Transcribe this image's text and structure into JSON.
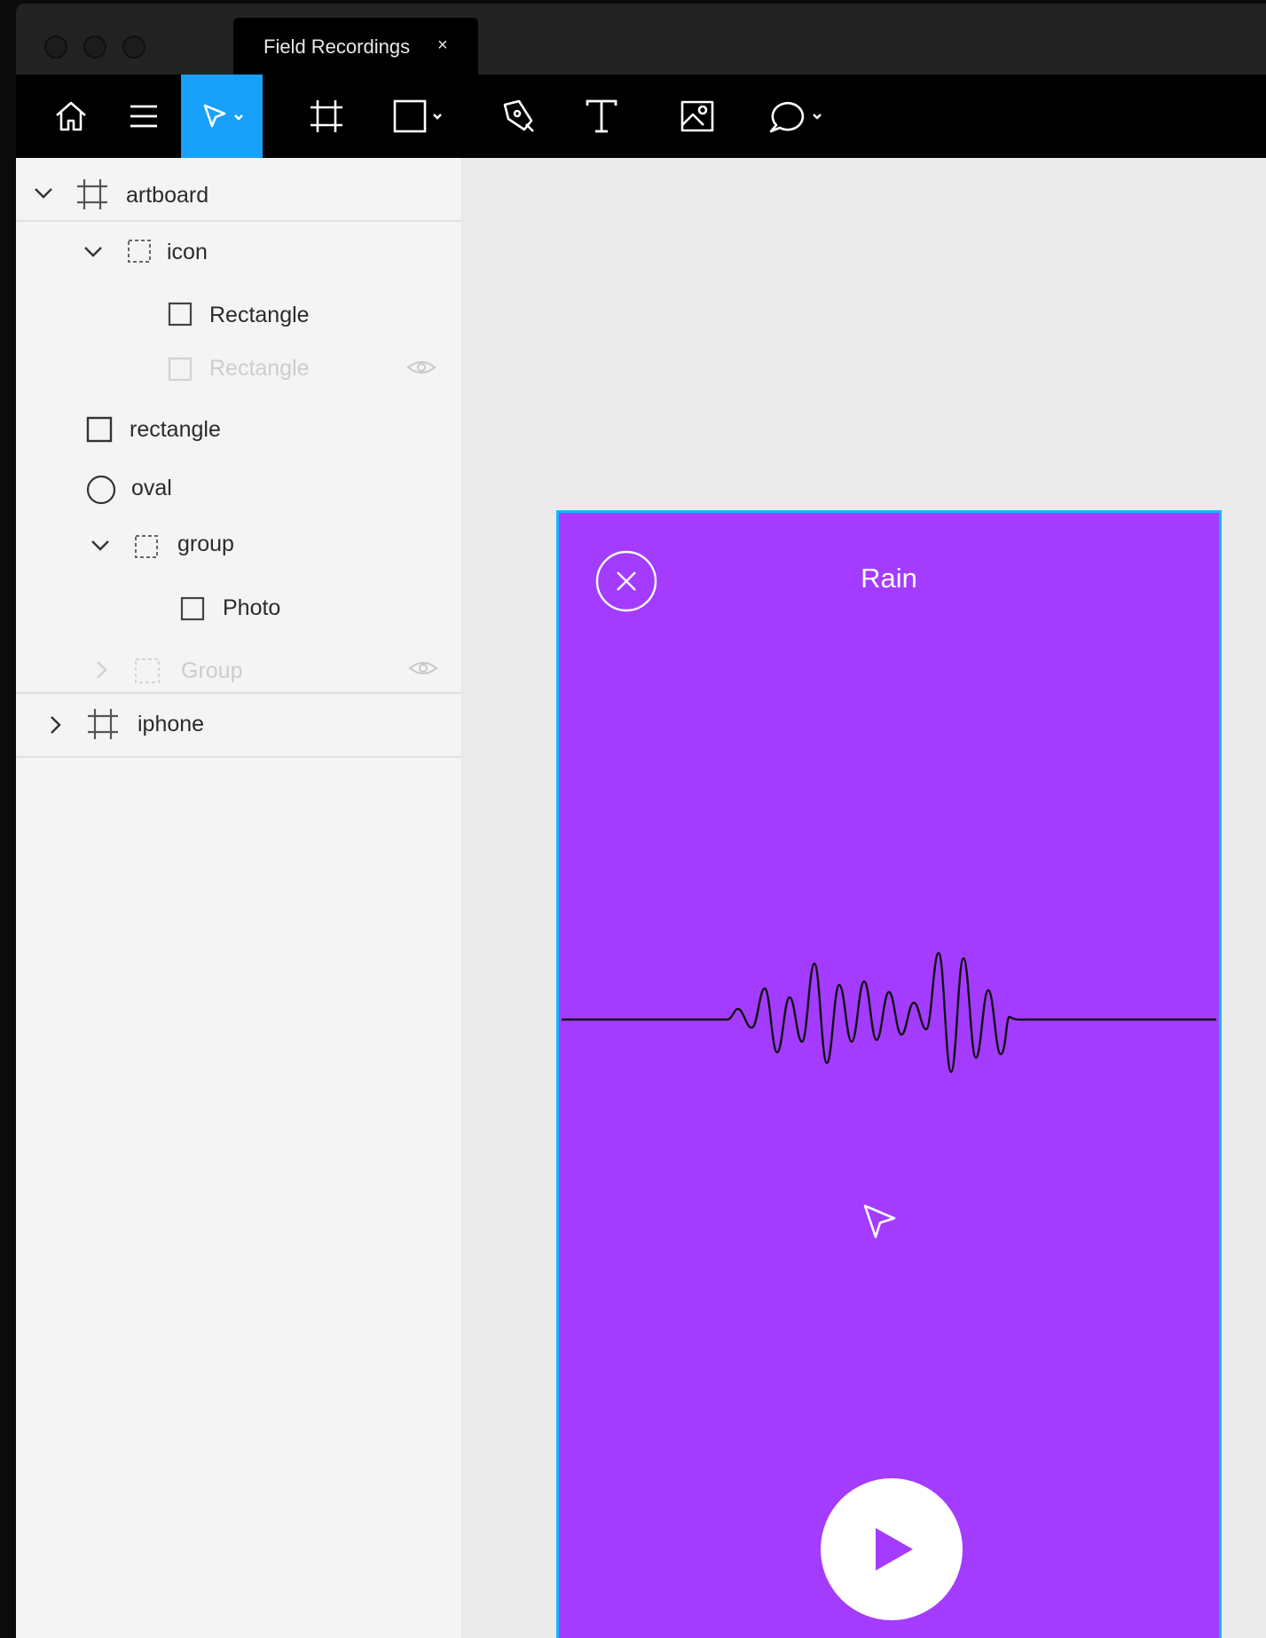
{
  "window": {
    "tab_title": "Field Recordings",
    "tab_close": "×"
  },
  "toolbar": {
    "tools": [
      "home-icon",
      "menu-icon",
      "select-tool",
      "frame-tool",
      "rectangle-tool",
      "pen-tool",
      "text-tool",
      "image-tool",
      "comment-tool"
    ],
    "active_tool": "select-tool",
    "accent_color": "#18a0fb"
  },
  "layers": {
    "items": [
      {
        "label": "artboard",
        "type": "artboard",
        "expanded": true
      },
      {
        "label": "icon",
        "type": "group",
        "expanded": true
      },
      {
        "label": "Rectangle",
        "type": "rectangle"
      },
      {
        "label": "Rectangle",
        "type": "rectangle",
        "hidden": true
      },
      {
        "label": "rectangle",
        "type": "rectangle"
      },
      {
        "label": "oval",
        "type": "ellipse"
      },
      {
        "label": "group",
        "type": "group",
        "expanded": true
      },
      {
        "label": "Photo",
        "type": "rectangle"
      },
      {
        "label": "Group",
        "type": "group",
        "hidden": true,
        "expanded": false
      },
      {
        "label": "iphone",
        "type": "artboard",
        "expanded": false
      }
    ]
  },
  "artboard": {
    "title": "Rain",
    "background_color": "#a33cff",
    "selection_color": "#18b4ff",
    "close_icon": "close-circle-icon",
    "play_icon": "play-icon"
  }
}
